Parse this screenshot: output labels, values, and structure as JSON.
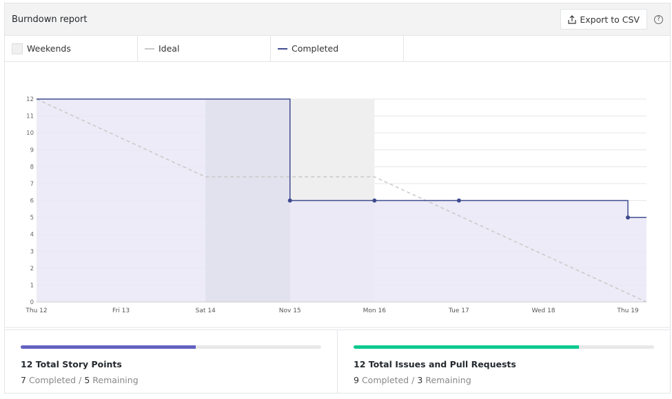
{
  "header": {
    "title": "Burndown report",
    "export_label": "Export to CSV",
    "help_icon": "question-circle-icon",
    "export_icon": "upload-icon"
  },
  "legend": [
    {
      "label": "Weekends",
      "color": "#f0f0f0"
    },
    {
      "label": "Ideal",
      "color": "#c8c8c8"
    },
    {
      "label": "Completed",
      "color": "#3f4a8e"
    }
  ],
  "chart_data": {
    "type": "line",
    "x_ticks": [
      "Thu 12",
      "Fri 13",
      "Sat 14",
      "Nov 15",
      "Mon 16",
      "Tue 17",
      "Wed 18",
      "Thu 19"
    ],
    "xlim": [
      0,
      7.22
    ],
    "ylim": [
      0,
      12
    ],
    "y_ticks": [
      0,
      1,
      2,
      3,
      4,
      5,
      6,
      7,
      8,
      9,
      10,
      11,
      12
    ],
    "grid": true,
    "weekends": [
      [
        2,
        4
      ]
    ],
    "series": [
      {
        "name": "Ideal",
        "style": "dashed",
        "color": "#c8c8c8",
        "points": [
          [
            0,
            12
          ],
          [
            2,
            7.4
          ],
          [
            4,
            7.4
          ],
          [
            7.22,
            0
          ]
        ]
      },
      {
        "name": "Completed",
        "style": "step",
        "color": "#3f4a8e",
        "fill": "#e9e8f6",
        "points": [
          [
            0,
            12
          ],
          [
            3,
            12
          ],
          [
            3,
            6
          ],
          [
            4,
            6
          ],
          [
            5,
            6
          ],
          [
            7,
            6
          ],
          [
            7,
            5
          ],
          [
            7.22,
            5
          ]
        ],
        "markers": [
          [
            3,
            6
          ],
          [
            4,
            6
          ],
          [
            5,
            6
          ],
          [
            7,
            5
          ]
        ]
      }
    ]
  },
  "stats": [
    {
      "title": "12 Total Story Points",
      "completed": "7",
      "completed_label": "Completed",
      "sep": "/",
      "remaining": "5",
      "remaining_label": "Remaining",
      "progress": 0.583,
      "color": "#6461c2"
    },
    {
      "title": "12 Total Issues and Pull Requests",
      "completed": "9",
      "completed_label": "Completed",
      "sep": "/",
      "remaining": "3",
      "remaining_label": "Remaining",
      "progress": 0.75,
      "color": "#0bc98e"
    }
  ]
}
